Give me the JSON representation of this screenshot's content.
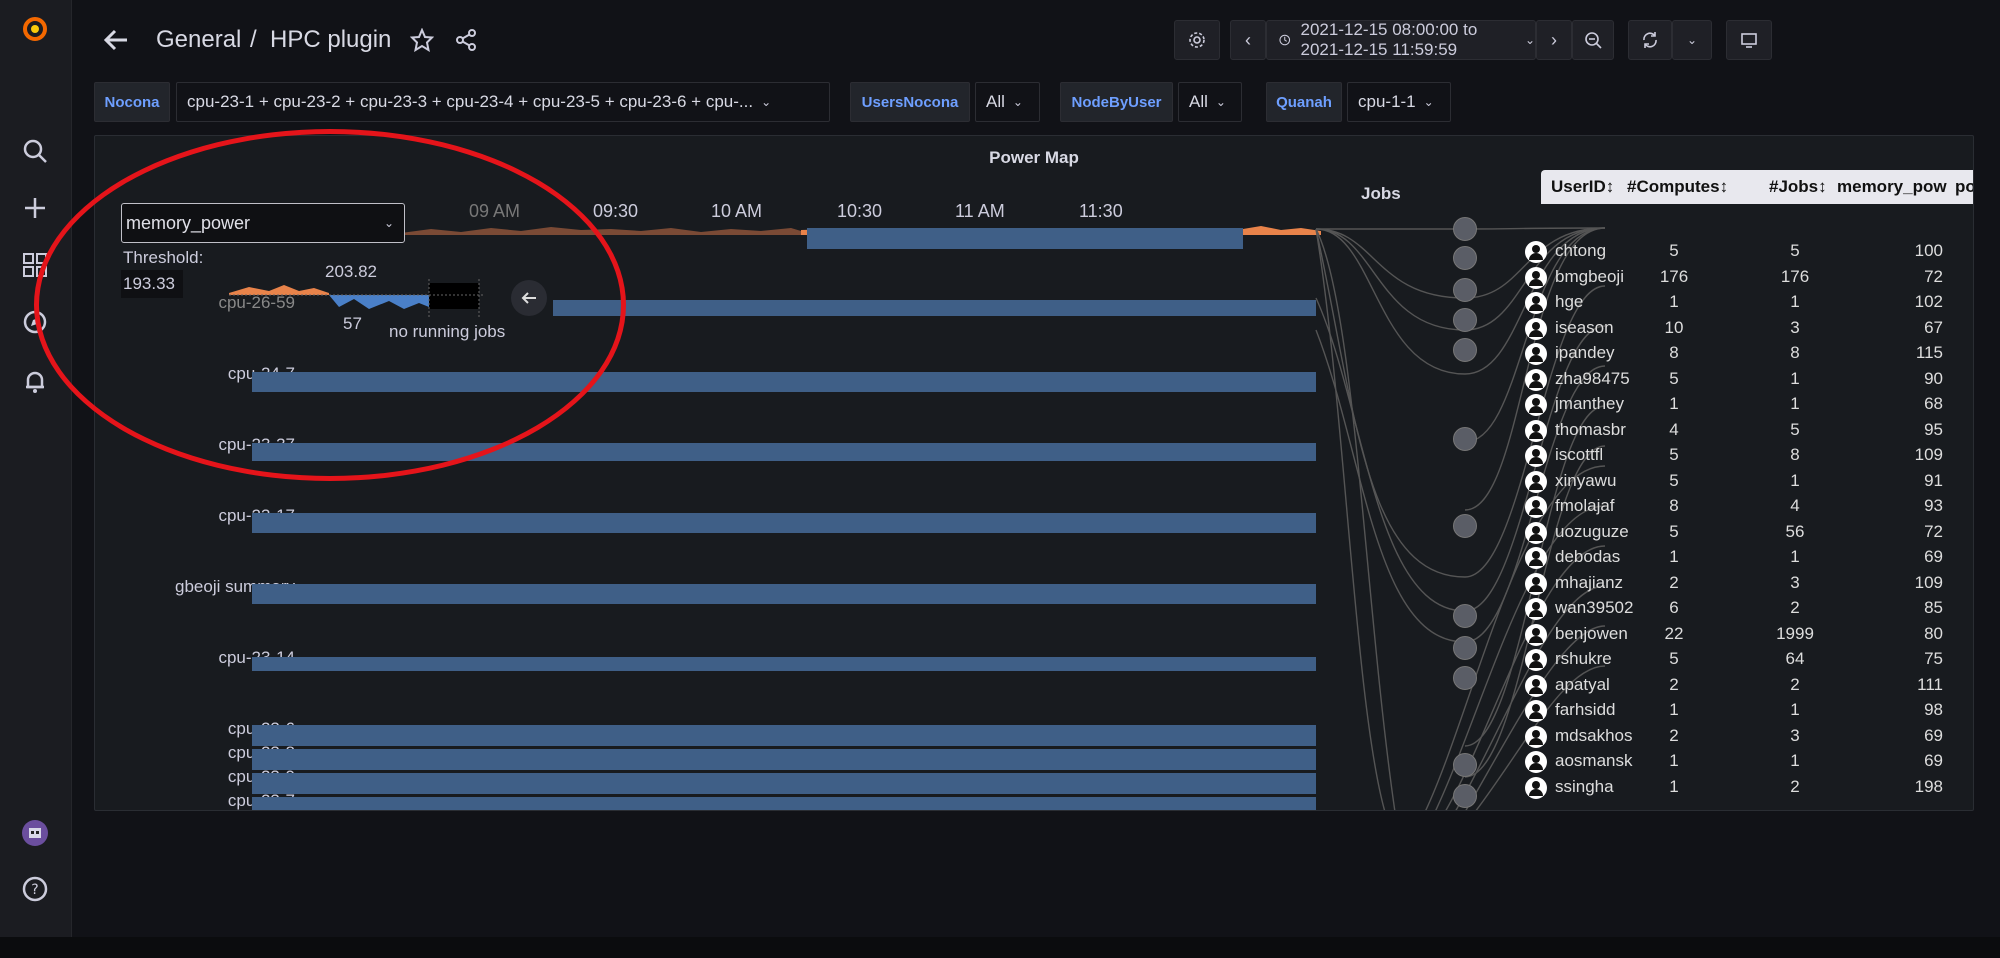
{
  "breadcrumb": {
    "folder": "General",
    "separator": "/",
    "dashboard": "HPC plugin"
  },
  "time_range": {
    "label": "2021-12-15 08:00:00 to 2021-12-15 11:59:59"
  },
  "variables": [
    {
      "label": "Nocona",
      "value": "cpu-23-1 + cpu-23-2 + cpu-23-3 + cpu-23-4 + cpu-23-5 + cpu-23-6 + cpu-..."
    },
    {
      "label": "UsersNocona",
      "value": "All"
    },
    {
      "label": "NodeByUser",
      "value": "All"
    },
    {
      "label": "Quanah",
      "value": "cpu-1-1"
    }
  ],
  "panel": {
    "title": "Power Map",
    "metric_select": "memory_power",
    "threshold_label": "Threshold:",
    "threshold_value": "193.33",
    "legend_max": "203.82",
    "legend_min": "57",
    "no_jobs_text": "no running jobs",
    "time_ticks": [
      "09 AM",
      "09:30",
      "10 AM",
      "10:30",
      "11 AM",
      "11:30"
    ],
    "nodes": [
      "cpu-26-59",
      "cpu-24-7",
      "cpu-23-37",
      "cpu-23-17",
      "gbeoji summary",
      "cpu-23-14",
      "cpu-23-6",
      "cpu-23-8",
      "cpu-23-9",
      "cpu-23-7"
    ],
    "jobs_title": "Jobs"
  },
  "table": {
    "headers": [
      "UserID↕",
      "#Computes↕",
      "#Jobs↕",
      "memory_pow",
      "pow"
    ],
    "rows": [
      {
        "user": "chtong",
        "computes": "5",
        "jobs": "5",
        "memory_power": "100"
      },
      {
        "user": "bmgbeoji",
        "computes": "176",
        "jobs": "176",
        "memory_power": "72"
      },
      {
        "user": "hge",
        "computes": "1",
        "jobs": "1",
        "memory_power": "102"
      },
      {
        "user": "iseason",
        "computes": "10",
        "jobs": "3",
        "memory_power": "67"
      },
      {
        "user": "ipandey",
        "computes": "8",
        "jobs": "8",
        "memory_power": "115"
      },
      {
        "user": "zha98475",
        "computes": "5",
        "jobs": "1",
        "memory_power": "90"
      },
      {
        "user": "jmanthey",
        "computes": "1",
        "jobs": "1",
        "memory_power": "68"
      },
      {
        "user": "thomasbr",
        "computes": "4",
        "jobs": "5",
        "memory_power": "95"
      },
      {
        "user": "iscottfl",
        "computes": "5",
        "jobs": "8",
        "memory_power": "109"
      },
      {
        "user": "xinyawu",
        "computes": "5",
        "jobs": "1",
        "memory_power": "91"
      },
      {
        "user": "fmolajaf",
        "computes": "8",
        "jobs": "4",
        "memory_power": "93"
      },
      {
        "user": "uozuguze",
        "computes": "5",
        "jobs": "56",
        "memory_power": "72"
      },
      {
        "user": "debodas",
        "computes": "1",
        "jobs": "1",
        "memory_power": "69"
      },
      {
        "user": "mhajianz",
        "computes": "2",
        "jobs": "3",
        "memory_power": "109"
      },
      {
        "user": "wan39502",
        "computes": "6",
        "jobs": "2",
        "memory_power": "85"
      },
      {
        "user": "benjowen",
        "computes": "22",
        "jobs": "1999",
        "memory_power": "80"
      },
      {
        "user": "rshukre",
        "computes": "5",
        "jobs": "64",
        "memory_power": "75"
      },
      {
        "user": "apatyal",
        "computes": "2",
        "jobs": "2",
        "memory_power": "111"
      },
      {
        "user": "farhsidd",
        "computes": "1",
        "jobs": "1",
        "memory_power": "98"
      },
      {
        "user": "mdsakhos",
        "computes": "2",
        "jobs": "3",
        "memory_power": "69"
      },
      {
        "user": "aosmansk",
        "computes": "1",
        "jobs": "1",
        "memory_power": "69"
      },
      {
        "user": "ssingha",
        "computes": "1",
        "jobs": "2",
        "memory_power": "198"
      }
    ]
  },
  "colors": {
    "accent": "#6e9fff",
    "bar": "#3f5f87",
    "heat": "#e8834a",
    "annotation": "#e5141a",
    "background": "#111217"
  }
}
